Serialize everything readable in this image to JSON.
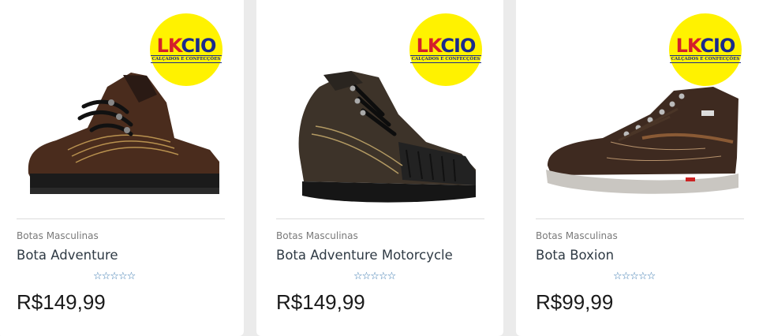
{
  "brand": {
    "logo_text_main": "LKCIO",
    "logo_text_sub": "CALÇADOS E CONFECÇÕES",
    "logo_color_bg": "#fff200",
    "logo_color_primary": "#1a2a8c",
    "logo_color_accent": "#d4202a"
  },
  "products": [
    {
      "category": "Botas Masculinas",
      "name": "Bota Adventure",
      "price": "R$149,99",
      "rating_stars": "☆☆☆☆☆",
      "rating_value": 0,
      "image": "brown-hiking-boot"
    },
    {
      "category": "Botas Masculinas",
      "name": "Bota Adventure Motorcycle",
      "price": "R$149,99",
      "rating_stars": "☆☆☆☆☆",
      "rating_value": 0,
      "image": "dark-motorcycle-boot"
    },
    {
      "category": "Botas Masculinas",
      "name": "Bota Boxion",
      "price": "R$99,99",
      "rating_stars": "☆☆☆☆☆",
      "rating_value": 0,
      "image": "brown-high-top-sneaker"
    }
  ]
}
